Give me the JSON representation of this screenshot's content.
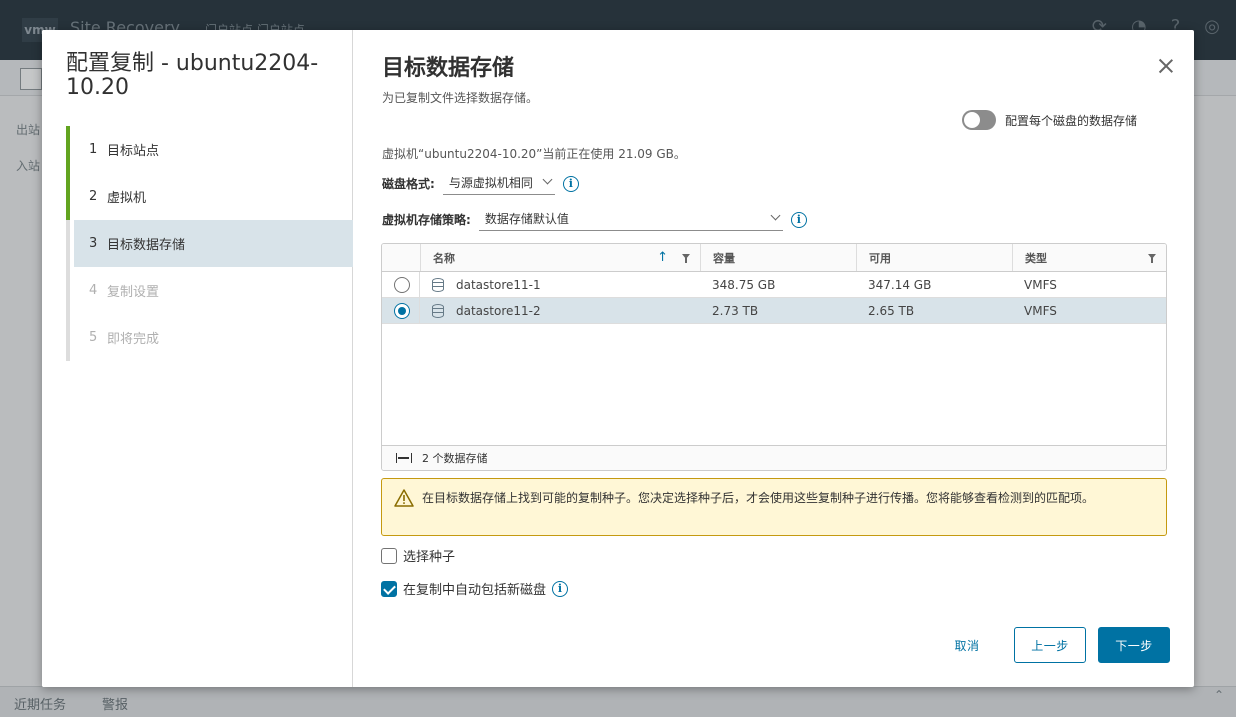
{
  "background": {
    "logo": "vmw",
    "app_title": "Site Recovery",
    "nav": "门户站点  门户站点",
    "sidebar_item_1": "出站",
    "sidebar_item_2": "入站",
    "bottom_tab_tasks": "近期任务",
    "bottom_tab_alarms": "警报"
  },
  "wizard": {
    "title": "配置复制 - ubuntu2204-10.20",
    "steps": [
      {
        "num": "1",
        "label": "目标站点",
        "state": "done"
      },
      {
        "num": "2",
        "label": "虚拟机",
        "state": "done"
      },
      {
        "num": "3",
        "label": "目标数据存储",
        "state": "current"
      },
      {
        "num": "4",
        "label": "复制设置",
        "state": "disabled"
      },
      {
        "num": "5",
        "label": "即将完成",
        "state": "disabled"
      }
    ]
  },
  "page": {
    "title": "目标数据存储",
    "subtitle": "为已复制文件选择数据存储。",
    "toggle_label": "配置每个磁盘的数据存储",
    "usage_text": "虚拟机“ubuntu2204-10.20”当前正在使用 21.09 GB。",
    "disk_format_label": "磁盘格式:",
    "disk_format_value": "与源虚拟机相同",
    "policy_label": "虚拟机存储策略:",
    "policy_value": "数据存储默认值"
  },
  "grid": {
    "columns": {
      "name": "名称",
      "capacity": "容量",
      "free": "可用",
      "type": "类型"
    },
    "rows": [
      {
        "name": "datastore11-1",
        "capacity": "348.75 GB",
        "free": "347.14 GB",
        "type": "VMFS",
        "selected": false
      },
      {
        "name": "datastore11-2",
        "capacity": "2.73 TB",
        "free": "2.65 TB",
        "type": "VMFS",
        "selected": true
      }
    ],
    "footer": "2 个数据存储"
  },
  "alert": {
    "text": "在目标数据存储上找到可能的复制种子。您决定选择种子后，才会使用这些复制种子进行传播。您将能够查看检测到的匹配项。"
  },
  "options": {
    "select_seed": "选择种子",
    "auto_include": "在复制中自动包括新磁盘"
  },
  "buttons": {
    "cancel": "取消",
    "back": "上一步",
    "next": "下一步"
  },
  "colors": {
    "primary": "#0072a3",
    "done_step": "#62a420",
    "warning_border": "#c59a10",
    "warning_bg": "#fff7d6"
  }
}
